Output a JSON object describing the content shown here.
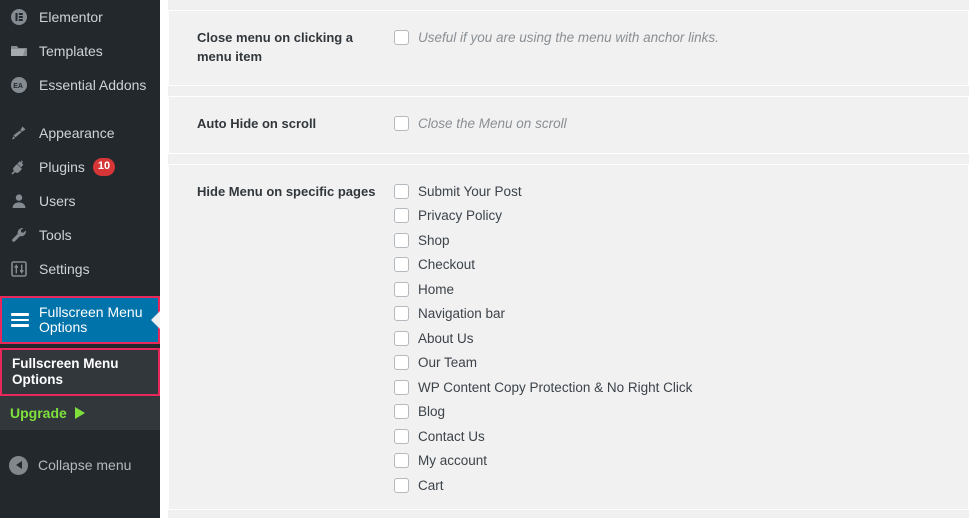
{
  "sidebar": {
    "items": [
      {
        "label": "Elementor",
        "icon": "elementor-icon",
        "badge": null
      },
      {
        "label": "Templates",
        "icon": "folder-icon",
        "badge": null
      },
      {
        "label": "Essential Addons",
        "icon": "essential-addons-icon",
        "badge": null
      },
      {
        "label": "Appearance",
        "icon": "paintbrush-icon",
        "badge": null
      },
      {
        "label": "Plugins",
        "icon": "plug-icon",
        "badge": "10"
      },
      {
        "label": "Users",
        "icon": "user-icon",
        "badge": null
      },
      {
        "label": "Tools",
        "icon": "wrench-icon",
        "badge": null
      },
      {
        "label": "Settings",
        "icon": "sliders-icon",
        "badge": null
      }
    ],
    "active_item": {
      "label": "Fullscreen Menu Options",
      "icon": "hamburger-icon"
    },
    "submenu_item": {
      "label": "Fullscreen Menu Options"
    },
    "upgrade": {
      "label": "Upgrade",
      "icon": "arrow-right-icon"
    },
    "collapse": {
      "label": "Collapse menu",
      "icon": "chevron-left-circle-icon"
    },
    "colors": {
      "background": "#23282d",
      "submenu_background": "#32373c",
      "active_background": "#0073aa",
      "highlight_border": "#e8285a",
      "upgrade_text": "#7fe03c",
      "badge_background": "#d63638"
    }
  },
  "settings": {
    "rows": [
      {
        "label": "Close menu on clicking a menu item",
        "checkbox_label": "Useful if you are using the menu with anchor links.",
        "checked": false
      },
      {
        "label": "Auto Hide on scroll",
        "checkbox_label": "Close the Menu on scroll",
        "checked": false
      }
    ],
    "pages_row": {
      "label": "Hide Menu on specific pages",
      "pages": [
        {
          "label": "Submit Your Post",
          "checked": false
        },
        {
          "label": "Privacy Policy",
          "checked": false
        },
        {
          "label": "Shop",
          "checked": false
        },
        {
          "label": "Checkout",
          "checked": false
        },
        {
          "label": "Home",
          "checked": false
        },
        {
          "label": "Navigation bar",
          "checked": false
        },
        {
          "label": "About Us",
          "checked": false
        },
        {
          "label": "Our Team",
          "checked": false
        },
        {
          "label": "WP Content Copy Protection & No Right Click",
          "checked": false
        },
        {
          "label": "Blog",
          "checked": false
        },
        {
          "label": "Contact Us",
          "checked": false
        },
        {
          "label": "My account",
          "checked": false
        },
        {
          "label": "Cart",
          "checked": false
        }
      ]
    }
  }
}
